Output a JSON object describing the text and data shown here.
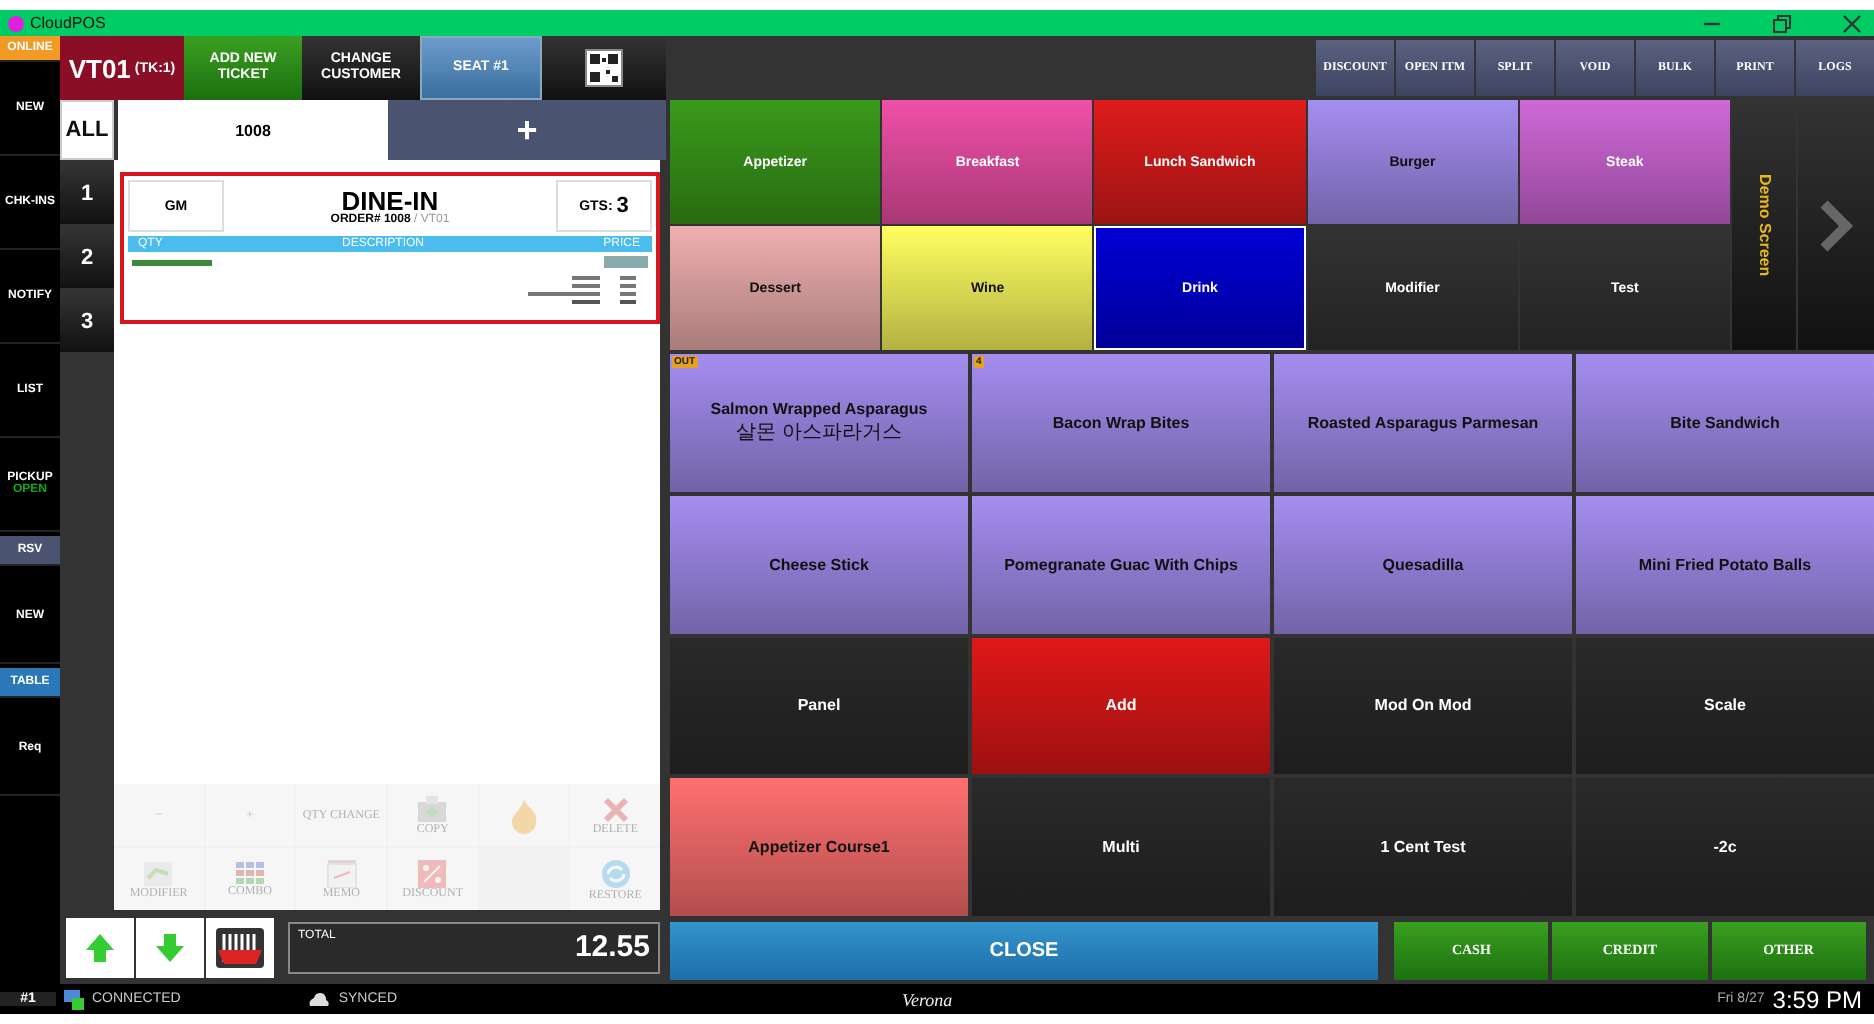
{
  "window": {
    "title": "CloudPOS"
  },
  "nav": [
    {
      "label": "ONLINE",
      "kind": "status"
    },
    {
      "label": "NEW",
      "kind": "plain"
    },
    {
      "label": "CHK-INS",
      "kind": "plain"
    },
    {
      "label": "NOTIFY",
      "kind": "plain"
    },
    {
      "label": "LIST",
      "kind": "plain"
    },
    {
      "label": "PICKUP",
      "sublabel": "OPEN",
      "kind": "plain"
    },
    {
      "label": "RSV",
      "kind": "tag"
    },
    {
      "label": "NEW",
      "kind": "plain"
    },
    {
      "label": "TABLE",
      "kind": "tag-active"
    },
    {
      "label": "Req",
      "kind": "plain"
    }
  ],
  "header": {
    "terminal": "VT01",
    "ticket_count": "(TK:1)",
    "buttons": [
      "ADD NEW TICKET",
      "CHANGE CUSTOMER",
      "SEAT #1"
    ]
  },
  "seats": [
    {
      "label": "ALL",
      "selected": true
    },
    {
      "label": "1",
      "selected": false
    },
    {
      "label": "2",
      "selected": false
    },
    {
      "label": "3",
      "selected": false
    }
  ],
  "ticket_tabs": {
    "order": "1008",
    "add": "+"
  },
  "ticket": {
    "server": "GM",
    "type": "DINE-IN",
    "order_label": "ORDER#",
    "order_number": "1008",
    "terminal": "/ VT01",
    "guests_label": "GTS:",
    "guests": "3",
    "columns": [
      "QTY",
      "DESCRIPTION",
      "PRICE"
    ]
  },
  "actions": [
    {
      "label": "−",
      "disabled": true
    },
    {
      "label": "+",
      "disabled": true
    },
    {
      "label": "QTY CHANGE",
      "disabled": true
    },
    {
      "label": "COPY",
      "disabled": true
    },
    {
      "disabled": true
    },
    {
      "label": "DELETE",
      "disabled": true
    },
    {
      "label": "MODIFIER",
      "disabled": true
    },
    {
      "label": "COMBO",
      "disabled": true
    },
    {
      "label": "MEMO",
      "disabled": true
    },
    {
      "label": "DISCOUNT",
      "disabled": true
    },
    {
      "label": "RESTORE",
      "disabled": true
    }
  ],
  "total": {
    "label": "TOTAL",
    "value": "12.55"
  },
  "toolbar": [
    "DISCOUNT",
    "OPEN ITM",
    "SPLIT",
    "VOID",
    "BULK",
    "PRINT",
    "LOGS"
  ],
  "categories": [
    {
      "label": "Appetizer",
      "color": "#3a9a1a",
      "selected": false
    },
    {
      "label": "Breakfast",
      "color": "#f050a8",
      "selected": false
    },
    {
      "label": "Lunch Sandwich",
      "color": "#e01c1c",
      "selected": false
    },
    {
      "label": "Burger",
      "color": "#a48ef0",
      "selected": false
    },
    {
      "label": "Steak",
      "color": "#d068d8",
      "selected": false
    },
    {
      "label": "Dessert",
      "color": "#f0b0b0",
      "selected": false
    },
    {
      "label": "Wine",
      "color": "#ffff60",
      "selected": false
    },
    {
      "label": "Drink",
      "color": "#0000d8",
      "selected": true
    },
    {
      "label": "Modifier",
      "color": "#333333",
      "selected": false
    },
    {
      "label": "Test",
      "color": "#333333",
      "selected": false
    }
  ],
  "screen_label": "Demo Screen",
  "items": [
    {
      "label": "Salmon Wrapped Asparagus",
      "sublabel": "살몬 아스파라거스",
      "badge": "OUT",
      "color": "#a48ef0"
    },
    {
      "label": "Bacon Wrap Bites",
      "badge": "4",
      "color": "#a48ef0"
    },
    {
      "label": "Roasted Asparagus Parmesan",
      "color": "#a48ef0"
    },
    {
      "label": "Bite Sandwich",
      "color": "#a48ef0"
    },
    {
      "label": "Cheese Stick",
      "color": "#a48ef0"
    },
    {
      "label": "Pomegranate Guac With Chips",
      "color": "#a48ef0"
    },
    {
      "label": "Quesadilla",
      "color": "#a48ef0"
    },
    {
      "label": "Mini Fried Potato Balls",
      "color": "#a48ef0"
    },
    {
      "label": "Panel",
      "color": "#2a2a2a"
    },
    {
      "label": "Add",
      "color": "#e01818"
    },
    {
      "label": "Mod On Mod",
      "color": "#2a2a2a"
    },
    {
      "label": "Scale",
      "color": "#2a2a2a"
    },
    {
      "label": "Appetizer Course1",
      "color": "#ff7070"
    },
    {
      "label": "Multi",
      "color": "#2a2a2a"
    },
    {
      "label": "1 Cent Test",
      "color": "#2a2a2a"
    },
    {
      "label": "-2c",
      "color": "#2a2a2a"
    }
  ],
  "close_button": "CLOSE",
  "payments": [
    "CASH",
    "CREDIT",
    "OTHER"
  ],
  "status_bar": {
    "station": "#1",
    "connection": "CONNECTED",
    "sync": "SYNCED",
    "store": "Verona",
    "date": "Fri 8/27",
    "time": "3:59 PM"
  }
}
